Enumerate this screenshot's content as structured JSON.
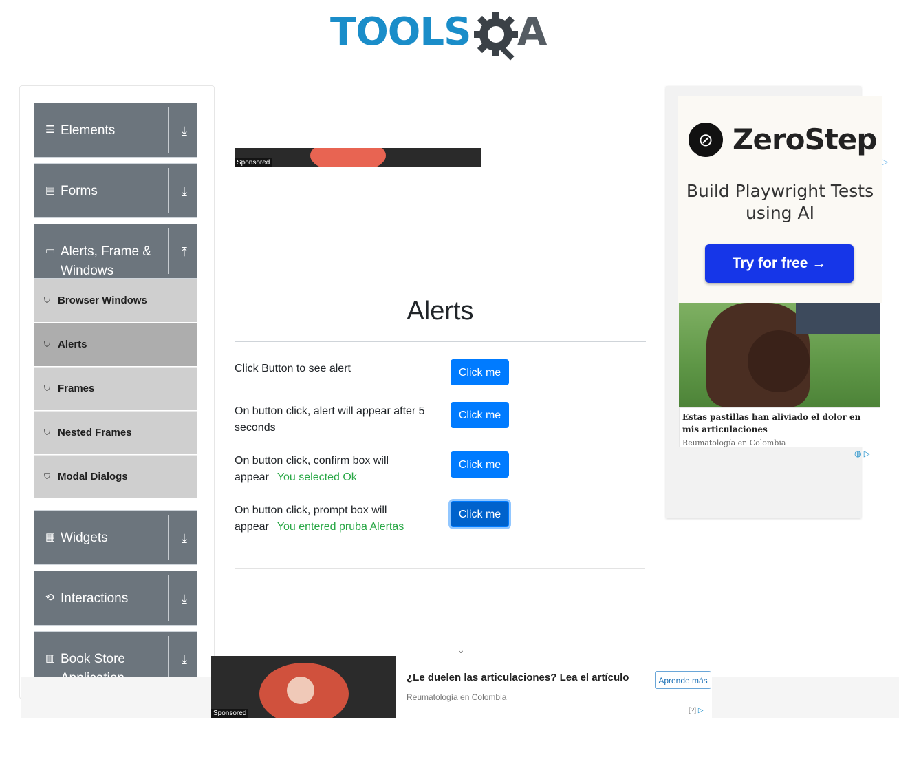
{
  "logo": {
    "tools": "TOOLS",
    "qa": "A"
  },
  "sidebar": {
    "groups": [
      {
        "label": "Elements",
        "icon": "menu-icon",
        "arrow": "download-arrow-icon"
      },
      {
        "label": "Forms",
        "icon": "document-icon",
        "arrow": "download-arrow-icon"
      },
      {
        "label": "Alerts, Frame & Windows",
        "icon": "window-icon",
        "arrow": "upload-arrow-icon"
      },
      {
        "label": "Widgets",
        "icon": "widgets-icon",
        "arrow": "download-arrow-icon"
      },
      {
        "label": "Interactions",
        "icon": "interactions-icon",
        "arrow": "download-arrow-icon"
      },
      {
        "label": "Book Store Application",
        "icon": "books-icon",
        "arrow": "download-arrow-icon"
      }
    ],
    "items": [
      {
        "label": "Browser Windows",
        "active": false
      },
      {
        "label": "Alerts",
        "active": true
      },
      {
        "label": "Frames",
        "active": false
      },
      {
        "label": "Nested Frames",
        "active": false
      },
      {
        "label": "Modal Dialogs",
        "active": false
      }
    ]
  },
  "sponsored_label": "Sponsored",
  "main": {
    "title": "Alerts",
    "rows": [
      {
        "text": "Click Button to see alert",
        "result": "",
        "button": "Click me"
      },
      {
        "text": "On button click, alert will appear after 5 seconds",
        "result": "",
        "button": "Click me"
      },
      {
        "text": "On button click, confirm box will appear",
        "result": "You selected Ok",
        "button": "Click me"
      },
      {
        "text": "On button click, prompt box will appear",
        "result": "You entered pruba Alertas",
        "button": "Click me"
      }
    ]
  },
  "right_ad": {
    "brand": "ZeroStep",
    "tagline": "Build Playwright Tests using AI",
    "cta": "Try for free →",
    "caption_title": "Estas pastillas han aliviado el dolor en mis articulaciones",
    "caption_source": "Reumatología en Colombia"
  },
  "bottom_ad": {
    "title": "¿Le duelen las articulaciones? Lea el artículo",
    "source": "Reumatología en Colombia",
    "button": "Aprende más",
    "choices": "[?]"
  },
  "colors": {
    "brand_blue": "#1a8dc9",
    "sidebar_header": "#6c757d",
    "button_primary": "#007bff",
    "success": "#28a745",
    "cta_blue": "#1636e8"
  }
}
